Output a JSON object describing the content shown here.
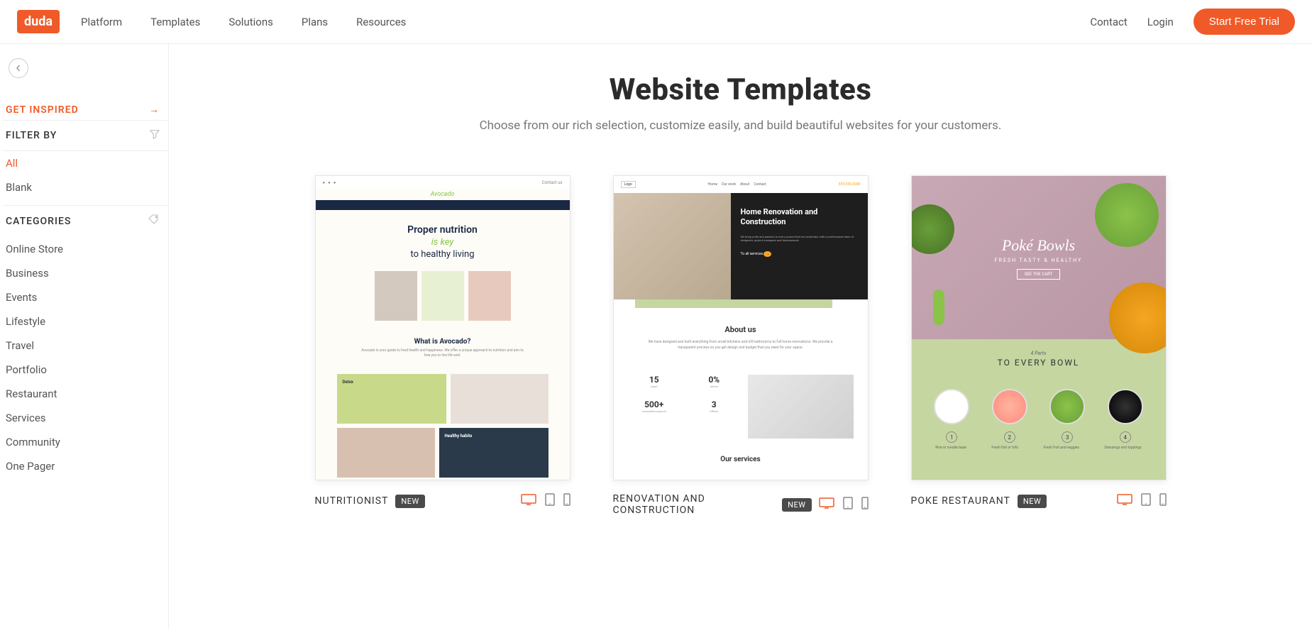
{
  "header": {
    "logo": "duda",
    "nav": [
      "Platform",
      "Templates",
      "Solutions",
      "Plans",
      "Resources"
    ],
    "contact": "Contact",
    "login": "Login",
    "cta": "Start Free Trial"
  },
  "sidebar": {
    "get_inspired": "GET INSPIRED",
    "filter_by": "FILTER BY",
    "filters": [
      "All",
      "Blank"
    ],
    "categories_label": "CATEGORIES",
    "categories": [
      "Online Store",
      "Business",
      "Events",
      "Lifestyle",
      "Travel",
      "Portfolio",
      "Restaurant",
      "Services",
      "Community",
      "One Pager"
    ]
  },
  "main": {
    "title": "Website Templates",
    "subtitle": "Choose from our rich selection, customize easily, and build beautiful websites for your customers."
  },
  "templates": [
    {
      "name": "NUTRITIONIST",
      "badge": "NEW",
      "preview": {
        "heading1": "Proper nutrition",
        "heading2": "is key",
        "heading3": "to healthy living",
        "section_title": "What is Avocado?",
        "card1": "Detox",
        "card2": "Healthy habits"
      }
    },
    {
      "name": "RENOVATION AND CONSTRUCTION",
      "badge": "NEW",
      "preview": {
        "hero_title": "Home Renovation and Construction",
        "about_title": "About us",
        "stats": [
          "15",
          "0%",
          "500+",
          "3"
        ],
        "services_title": "Our services"
      }
    },
    {
      "name": "POKE RESTAURANT",
      "badge": "NEW",
      "preview": {
        "hero_title": "Poké Bowls",
        "hero_sub": "FRESH TASTY & HEALTHY",
        "hero_btn": "SEE THE CART",
        "parts_sub": "4 Parts",
        "parts_title": "TO EVERY BOWL",
        "ingredients": [
          "Rice or noodle base",
          "Fresh fish or tofu",
          "Fresh fruit and veggies",
          "Dressings and toppings"
        ]
      }
    }
  ]
}
